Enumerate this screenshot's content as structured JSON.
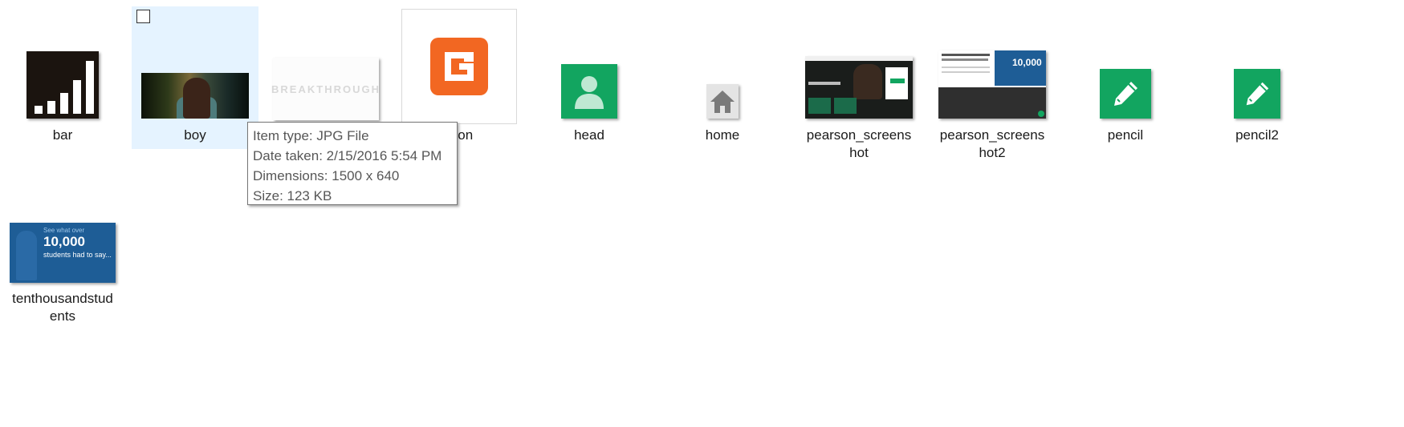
{
  "files": {
    "bar": "bar",
    "boy": "boy",
    "breakthrough": "",
    "favicon": "favicon",
    "head": "head",
    "home": "home",
    "pearson1": "pearson_screenshot",
    "pearson2": "pearson_screenshot2",
    "pencil": "pencil",
    "pencil2": "pencil2",
    "tenthousand": "tenthousandstudents"
  },
  "visible_labels": {
    "favicon_partial": "icon",
    "pearson1_line1": "pearson_screens",
    "pearson1_line2": "hot",
    "pearson2_line1": "pearson_screens",
    "pearson2_line2": "hot2",
    "ten_line1": "tenthousandstud",
    "ten_line2": "ents"
  },
  "tooltip": {
    "item_type": "Item type: JPG File",
    "date_taken": "Date taken: 2/15/2016 5:54 PM",
    "dimensions": "Dimensions: 1500 x 640",
    "size": "Size: 123 KB"
  },
  "thumb_text": {
    "breakthrough": "BREAKTHROUGH",
    "ten_small": "See what over",
    "ten_big": "10,000",
    "ten_sub": "students had to say..."
  },
  "colors": {
    "selection": "#e5f3ff",
    "green": "#12a560",
    "orange": "#f26722",
    "blue": "#1e5d96"
  },
  "icons": [
    "bar-chart-icon",
    "person-icon",
    "house-icon",
    "pencil-icon",
    "g-logo-icon"
  ]
}
